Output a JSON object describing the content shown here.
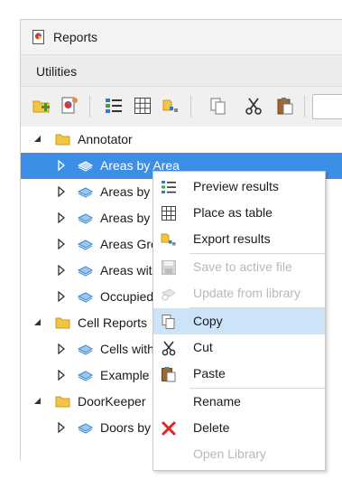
{
  "window": {
    "title": "Reports"
  },
  "menubar": {
    "utilities": "Utilities"
  },
  "toolbar": {
    "buttons": [
      "new-folder-icon",
      "new-report-icon",
      "preview-results-icon",
      "place-as-table-icon",
      "export-results-icon",
      "copy-icon",
      "cut-icon",
      "paste-icon"
    ]
  },
  "tree": {
    "groups": [
      {
        "label": "Annotator",
        "expanded": true,
        "items": [
          "Areas by Area",
          "Areas by",
          "Areas by",
          "Areas Gro",
          "Areas wit",
          "Occupied"
        ]
      },
      {
        "label": "Cell Reports",
        "expanded": true,
        "items": [
          "Cells with",
          "Example"
        ]
      },
      {
        "label": "DoorKeeper",
        "expanded": true,
        "items": [
          "Doors by"
        ]
      }
    ],
    "selected": "Areas by Area"
  },
  "context_menu": {
    "items": [
      {
        "label": "Preview results",
        "icon": "preview-results-icon",
        "enabled": true
      },
      {
        "label": "Place as table",
        "icon": "table-icon",
        "enabled": true
      },
      {
        "label": "Export results",
        "icon": "export-icon",
        "enabled": true
      },
      {
        "label": "Save to active file",
        "icon": "save-icon",
        "enabled": false
      },
      {
        "label": "Update from library",
        "icon": "update-icon",
        "enabled": false
      },
      {
        "label": "Copy",
        "icon": "copy-icon",
        "enabled": true,
        "highlighted": true
      },
      {
        "label": "Cut",
        "icon": "cut-icon",
        "enabled": true
      },
      {
        "label": "Paste",
        "icon": "paste-icon",
        "enabled": true
      },
      {
        "label": "Rename",
        "icon": "",
        "enabled": true
      },
      {
        "label": "Delete",
        "icon": "delete-icon",
        "enabled": true
      },
      {
        "label": "Open Library",
        "icon": "",
        "enabled": false
      }
    ]
  },
  "colors": {
    "selection": "#3d8ee6",
    "menu_hover": "#cde3f8",
    "folder": "#f4c542",
    "delete": "#e02424"
  }
}
